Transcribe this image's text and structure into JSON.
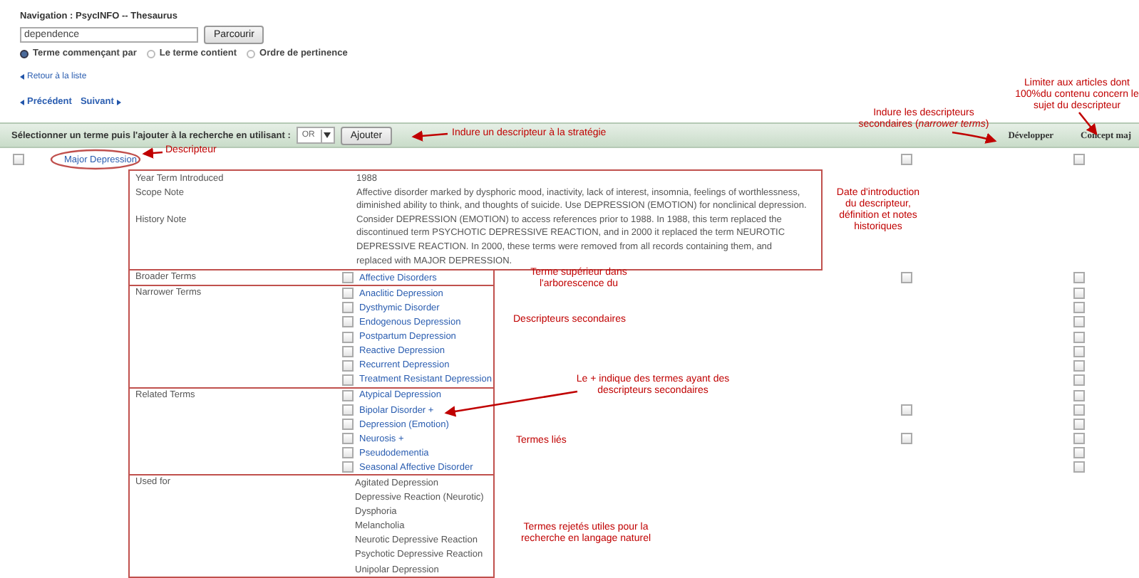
{
  "navigation": {
    "title": "Navigation : PsycINFO -- Thesaurus",
    "search_value": "dependence",
    "browse_button": "Parcourir",
    "options": [
      {
        "label": "Terme commençant par",
        "selected": true
      },
      {
        "label": "Le terme contient",
        "selected": false
      },
      {
        "label": "Ordre de pertinence",
        "selected": false
      }
    ]
  },
  "back_link": "Retour à la liste",
  "pager": {
    "previous": "Précédent",
    "next": "Suivant"
  },
  "toolbar": {
    "instruction": "Sélectionner un terme puis l'ajouter à la recherche en utilisant :",
    "operator": "OR",
    "add_button": "Ajouter",
    "columns": [
      "Développer",
      "Concept maj"
    ]
  },
  "descriptor": {
    "term": "Major Depression",
    "checked": false,
    "explode": false,
    "major": false
  },
  "details": [
    {
      "label": "Year Term Introduced",
      "value": "1988"
    },
    {
      "label": "Scope Note",
      "value": "Affective disorder marked by dysphoric mood, inactivity, lack of interest, insomnia, feelings of worthlessness, diminished ability to think, and thoughts of suicide. Use DEPRESSION (EMOTION) for nonclinical depression."
    },
    {
      "label": "History Note",
      "value": "Consider DEPRESSION (EMOTION) to access references prior to 1988. In 1988, this term replaced the discontinued term PSYCHOTIC DEPRESSIVE REACTION, and in 2000 it replaced the term NEUROTIC DEPRESSIVE REACTION. In 2000, these terms were removed from all records containing them, and replaced with MAJOR DEPRESSION."
    }
  ],
  "term_groups": [
    {
      "label": "Broader Terms",
      "kind": "link",
      "terms": [
        {
          "term": "Affective Disorders",
          "checked": false,
          "explode": false,
          "major": false
        }
      ]
    },
    {
      "label": "Narrower Terms",
      "kind": "link",
      "terms": [
        {
          "term": "Anaclitic Depression",
          "checked": false,
          "major": false
        },
        {
          "term": "Dysthymic Disorder",
          "checked": false,
          "major": false
        },
        {
          "term": "Endogenous Depression",
          "checked": false,
          "major": false
        },
        {
          "term": "Postpartum Depression",
          "checked": false,
          "major": false
        },
        {
          "term": "Reactive Depression",
          "checked": false,
          "major": false
        },
        {
          "term": "Recurrent Depression",
          "checked": false,
          "major": false
        },
        {
          "term": "Treatment Resistant Depression",
          "checked": false,
          "major": false
        }
      ]
    },
    {
      "label": "Related Terms",
      "kind": "link",
      "terms": [
        {
          "term": "Atypical Depression",
          "checked": false,
          "major": false
        },
        {
          "term": "Bipolar Disorder +",
          "checked": false,
          "explode": false,
          "major": false
        },
        {
          "term": "Depression (Emotion)",
          "checked": false,
          "major": false
        },
        {
          "term": "Neurosis +",
          "checked": false,
          "explode": false,
          "major": false
        },
        {
          "term": "Pseudodementia",
          "checked": false,
          "major": false
        },
        {
          "term": "Seasonal Affective Disorder",
          "checked": false,
          "major": false
        }
      ]
    },
    {
      "label": "Used for",
      "kind": "plain",
      "terms": [
        {
          "term": "Agitated Depression"
        },
        {
          "term": "Depressive Reaction (Neurotic)"
        },
        {
          "term": "Dysphoria"
        },
        {
          "term": "Melancholia"
        },
        {
          "term": "Neurotic Depressive Reaction"
        },
        {
          "term": "Psychotic Depressive Reaction"
        },
        {
          "term": "Unipolar Depression"
        }
      ]
    }
  ],
  "annotations": [
    "Indure un descripteur à la stratégie",
    "Descripteur",
    "Indure les descripteurs secondaires (*narrower terms*)",
    "Limiter aux articles dont 100%du contenu concern le sujet du descripteur",
    "Date d'introduction du descripteur, définition et notes historiques",
    "Terme supérieur dans l'arborescence du",
    "Descripteurs secondaires",
    "Le + indique des termes ayant des descripteurs secondaires",
    "Termes liés",
    "Termes rejetés utiles pour la recherche en langage naturel"
  ]
}
